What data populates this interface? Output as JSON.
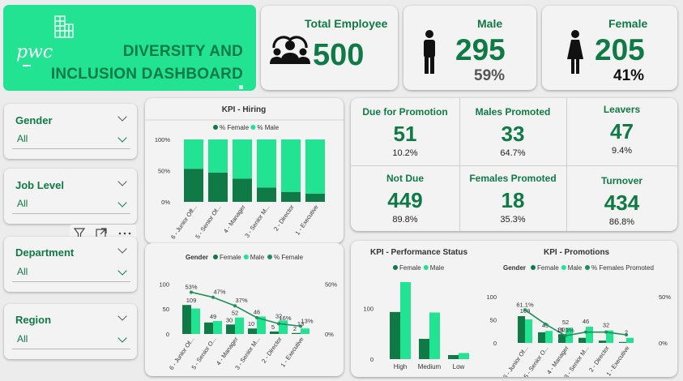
{
  "header": {
    "logo_text": "pwc",
    "title_line1": "DIVERSITY AND",
    "title_line2": "INCLUSION DASHBOARD"
  },
  "total": {
    "label": "Total Employee",
    "value": "500"
  },
  "male": {
    "label": "Male",
    "value": "295",
    "pct": "59%"
  },
  "female": {
    "label": "Female",
    "value": "205",
    "pct": "41%"
  },
  "slicers": [
    {
      "label": "Gender",
      "value": "All"
    },
    {
      "label": "Job Level",
      "value": "All"
    },
    {
      "label": "Department",
      "value": "All"
    },
    {
      "label": "Region",
      "value": "All"
    }
  ],
  "kpis": [
    {
      "label": "Due for Promotion",
      "value": "51",
      "pct": "10.2%"
    },
    {
      "label": "Males Promoted",
      "value": "33",
      "pct": "64.7%"
    },
    {
      "label": "Leavers",
      "value": "47",
      "pct": "9.4%"
    },
    {
      "label": "Not Due",
      "value": "449",
      "pct": "89.8%"
    },
    {
      "label": "Females Promoted",
      "value": "18",
      "pct": "35.3%"
    },
    {
      "label": "Turnover",
      "value": "434",
      "pct": "86.8%"
    }
  ],
  "colors": {
    "dark_green": "#0f7a45",
    "mid_green": "#1f8f5a",
    "light_green": "#21e391",
    "accent_green": "#16a75f"
  },
  "chart_data": [
    {
      "type": "bar",
      "title": "KPI - Hiring",
      "legend": [
        "% Female",
        "% Male"
      ],
      "categories": [
        "6 - Junior Off...",
        "5 - Senior Of...",
        "4 - Manager",
        "3 - Senior M...",
        "2 - Director",
        "1 - Executive"
      ],
      "series": [
        {
          "name": "% Female",
          "values": [
            53,
            47,
            37,
            23,
            16,
            13
          ]
        },
        {
          "name": "% Male",
          "values": [
            47,
            53,
            63,
            77,
            84,
            87
          ]
        }
      ],
      "y_ticks": [
        "0%",
        "50%",
        "100%"
      ],
      "ylim": [
        0,
        100
      ]
    },
    {
      "type": "bar",
      "title": "",
      "legend_title": "Gender",
      "legend": [
        "Female",
        "Male",
        "% Female"
      ],
      "categories": [
        "6 - Junior Of...",
        "5 - Senior O...",
        "4 - Manager",
        "3 - Senior M...",
        "2 - Director",
        "1 - Executive"
      ],
      "series": [
        {
          "name": "Female",
          "values": [
            58,
            23,
            19,
            11,
            5,
            2
          ]
        },
        {
          "name": "Male",
          "values": [
            51,
            26,
            33,
            35,
            27,
            11
          ]
        },
        {
          "name": "% Female",
          "values": [
            53,
            47,
            37,
            23,
            16,
            13
          ]
        }
      ],
      "bar_labels": [
        "109",
        "49",
        "52",
        "46",
        "32",
        "13"
      ],
      "female_labels": [
        "53%",
        "47%",
        "37%",
        "",
        "",
        ""
      ],
      "extra_labels": [
        "30",
        "10",
        "5",
        "2"
      ],
      "pct_labels": [
        "",
        "",
        "",
        "",
        "16%",
        "13%"
      ],
      "y_ticks": [
        "0",
        "50",
        "100"
      ],
      "y2_ticks": [
        "0%",
        "50%"
      ],
      "ylim": [
        0,
        120
      ]
    },
    {
      "type": "bar",
      "title": "KPI - Performance Status",
      "legend": [
        "Female",
        "Male"
      ],
      "categories": [
        "High",
        "Medium",
        "Low"
      ],
      "series": [
        {
          "name": "Female",
          "values": [
            93,
            40,
            8
          ]
        },
        {
          "name": "Male",
          "values": [
            152,
            92,
            12
          ]
        }
      ],
      "y_ticks": [
        "0",
        "100"
      ],
      "ylim": [
        0,
        160
      ]
    },
    {
      "type": "bar",
      "title": "KPI - Promotions",
      "legend_title": "Gender",
      "legend": [
        "Female",
        "Male",
        "% Females Promoted"
      ],
      "categories": [
        "6 - Junior Of...",
        "5 - Senior O...",
        "4 - Manager",
        "3 - Senior M...",
        "2 - Director",
        "1 - Executive"
      ],
      "series": [
        {
          "name": "Female",
          "values": [
            58,
            23,
            19,
            11,
            5,
            2
          ]
        },
        {
          "name": "Male",
          "values": [
            51,
            26,
            33,
            35,
            27,
            11
          ]
        },
        {
          "name": "% Females Promoted",
          "values": [
            61.1,
            35,
            13.3,
            20,
            20,
            15
          ]
        }
      ],
      "bar_labels": [
        "109",
        "49",
        "52",
        "46",
        "32",
        "2"
      ],
      "extra_labels": [
        "30"
      ],
      "pct_labels": [
        "61.1%",
        "",
        "13.3%",
        "",
        "",
        ""
      ],
      "y_ticks": [
        "0",
        "50",
        "100"
      ],
      "y2_ticks": [
        "0%",
        "50%"
      ],
      "ylim": [
        0,
        130
      ]
    }
  ]
}
